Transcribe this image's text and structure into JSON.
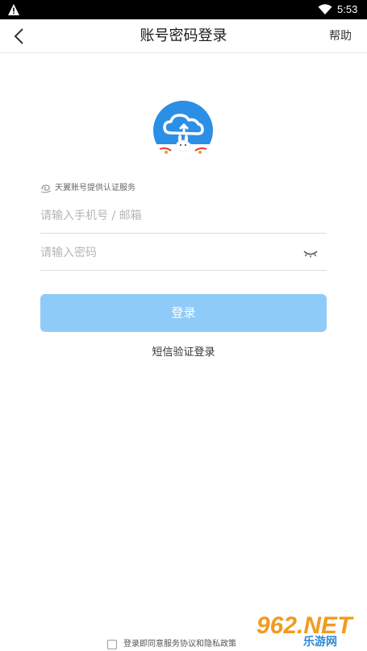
{
  "status_bar": {
    "time": "5:53"
  },
  "header": {
    "title": "账号密码登录",
    "help_label": "帮助"
  },
  "auth": {
    "note": "天翼账号提供认证服务"
  },
  "form": {
    "phone_placeholder": "请输入手机号 / 邮箱",
    "password_placeholder": "请输入密码",
    "login_label": "登录",
    "sms_login_label": "短信验证登录"
  },
  "footer": {
    "agreement_label": "登录即同意服务协议和隐私政策",
    "agreement_checked": false
  },
  "watermark": {
    "brand": "962.NET",
    "sub": "乐游网"
  },
  "colors": {
    "login_button": "#8fcbf8",
    "logo_blue": "#2b8fe6"
  }
}
